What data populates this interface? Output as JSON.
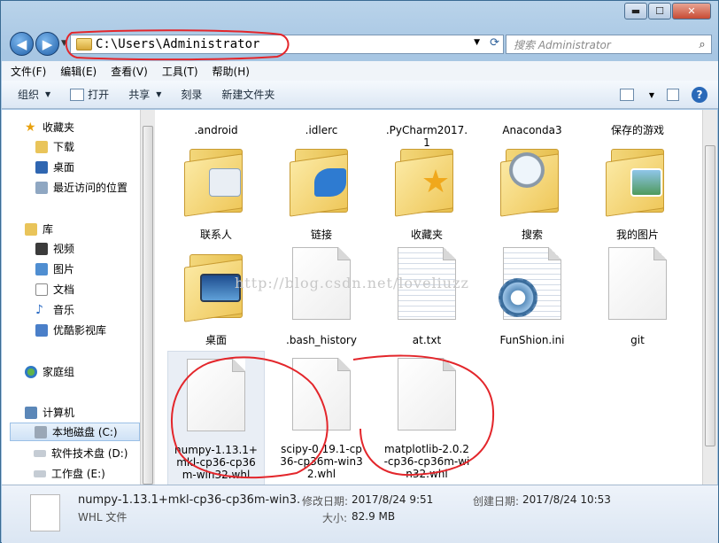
{
  "window": {
    "caption": {
      "minimize": "▬",
      "maximize": "☐",
      "close": "✕"
    }
  },
  "nav": {
    "back": "◀",
    "forward": "▶",
    "address": "C:\\Users\\Administrator",
    "search_placeholder": "搜索 Administrator"
  },
  "menu": [
    "文件(F)",
    "编辑(E)",
    "查看(V)",
    "工具(T)",
    "帮助(H)"
  ],
  "toolbar": {
    "organize": "组织",
    "open": "打开",
    "share": "共享",
    "burn": "刻录",
    "new_folder": "新建文件夹"
  },
  "sidebar": {
    "favorites": "收藏夹",
    "downloads": "下载",
    "desktop": "桌面",
    "recent": "最近访问的位置",
    "libraries": "库",
    "videos": "视频",
    "pictures": "图片",
    "documents": "文档",
    "music": "音乐",
    "youku": "优酷影视库",
    "homegroup": "家庭组",
    "computer": "计算机",
    "drive_c": "本地磁盘 (C:)",
    "drive_d": "软件技术盘 (D:)",
    "drive_e": "工作盘 (E:)"
  },
  "files": {
    "row0": [
      ".android",
      ".idlerc",
      ".PyCharm2017.1",
      "Anaconda3",
      "保存的游戏"
    ],
    "row1": [
      "联系人",
      "链接",
      "收藏夹",
      "搜索",
      "我的图片"
    ],
    "row2": [
      "桌面",
      ".bash_history",
      "at.txt",
      "FunShion.ini",
      "git"
    ],
    "row3": [
      "numpy-1.13.1+mkl-cp36-cp36m-win32.whl",
      "scipy-0.19.1-cp36-cp36m-win32.whl",
      "matplotlib-2.0.2-cp36-cp36m-win32.whl"
    ]
  },
  "watermark": "http://blog.csdn.net/loveliuzz",
  "status": {
    "name": "numpy-1.13.1+mkl-cp36-cp36m-win3...",
    "type": "WHL 文件",
    "modified_label": "修改日期:",
    "modified": "2017/8/24 9:51",
    "created_label": "创建日期:",
    "created": "2017/8/24 10:53",
    "size_label": "大小:",
    "size": "82.9 MB"
  },
  "colors": {
    "annotation": "#e3262b",
    "selection": "#cfe2f6"
  }
}
